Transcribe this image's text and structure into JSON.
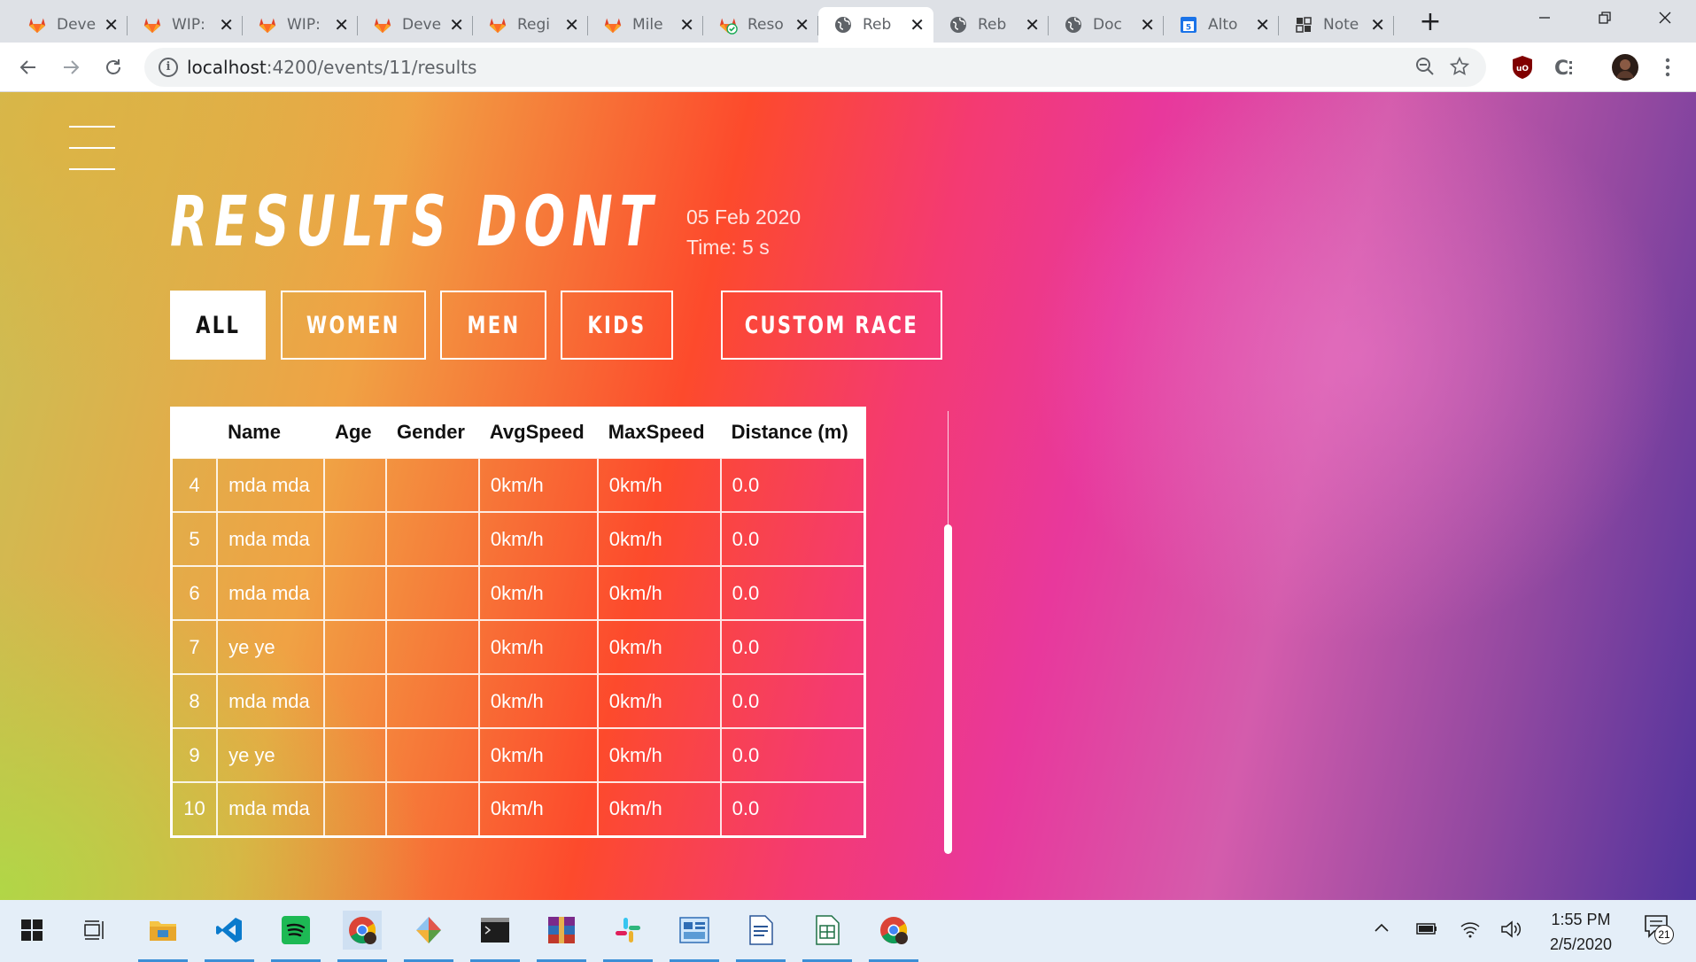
{
  "browser": {
    "tabs": [
      {
        "title": "Deve",
        "icon": "gitlab-icon",
        "active": false
      },
      {
        "title": "WIP:",
        "icon": "gitlab-icon",
        "active": false
      },
      {
        "title": "WIP:",
        "icon": "gitlab-icon",
        "active": false
      },
      {
        "title": "Deve",
        "icon": "gitlab-icon",
        "active": false
      },
      {
        "title": "Regi",
        "icon": "gitlab-icon",
        "active": false
      },
      {
        "title": "Mile",
        "icon": "gitlab-icon",
        "active": false
      },
      {
        "title": "Reso",
        "icon": "gitlab-check-icon",
        "active": false
      },
      {
        "title": "Reb",
        "icon": "globe-icon",
        "active": true
      },
      {
        "title": "Reb",
        "icon": "globe-icon",
        "active": false
      },
      {
        "title": "Doc",
        "icon": "globe-icon",
        "active": false
      },
      {
        "title": "Alto",
        "icon": "calendar-icon",
        "active": false
      },
      {
        "title": "Note",
        "icon": "notebook-icon",
        "active": false
      }
    ],
    "close_glyph": "✕",
    "new_tab_glyph": "+",
    "url_host": "localhost",
    "url_path": ":4200/events/11/results",
    "info_glyph": "i"
  },
  "page": {
    "title": "RESULTS DONT",
    "date": "05 Feb 2020",
    "time": "Time: 5 s",
    "filters": {
      "all": "ALL",
      "women": "WOMEN",
      "men": "MEN",
      "kids": "KIDS",
      "custom": "CUSTOM RACE"
    },
    "active_filter": "all",
    "table": {
      "headers": [
        "",
        "Name",
        "Age",
        "Gender",
        "AvgSpeed",
        "MaxSpeed",
        "Distance (m)"
      ],
      "rows": [
        [
          "4",
          "mda mda",
          "",
          "",
          "0km/h",
          "0km/h",
          "0.0"
        ],
        [
          "5",
          "mda mda",
          "",
          "",
          "0km/h",
          "0km/h",
          "0.0"
        ],
        [
          "6",
          "mda mda",
          "",
          "",
          "0km/h",
          "0km/h",
          "0.0"
        ],
        [
          "7",
          "ye ye",
          "",
          "",
          "0km/h",
          "0km/h",
          "0.0"
        ],
        [
          "8",
          "mda mda",
          "",
          "",
          "0km/h",
          "0km/h",
          "0.0"
        ],
        [
          "9",
          "ye ye",
          "",
          "",
          "0km/h",
          "0km/h",
          "0.0"
        ],
        [
          "10",
          "mda mda",
          "",
          "",
          "0km/h",
          "0km/h",
          "0.0"
        ]
      ]
    }
  },
  "taskbar": {
    "clock_time": "1:55 PM",
    "clock_date": "2/5/2020",
    "notification_count": "21"
  }
}
